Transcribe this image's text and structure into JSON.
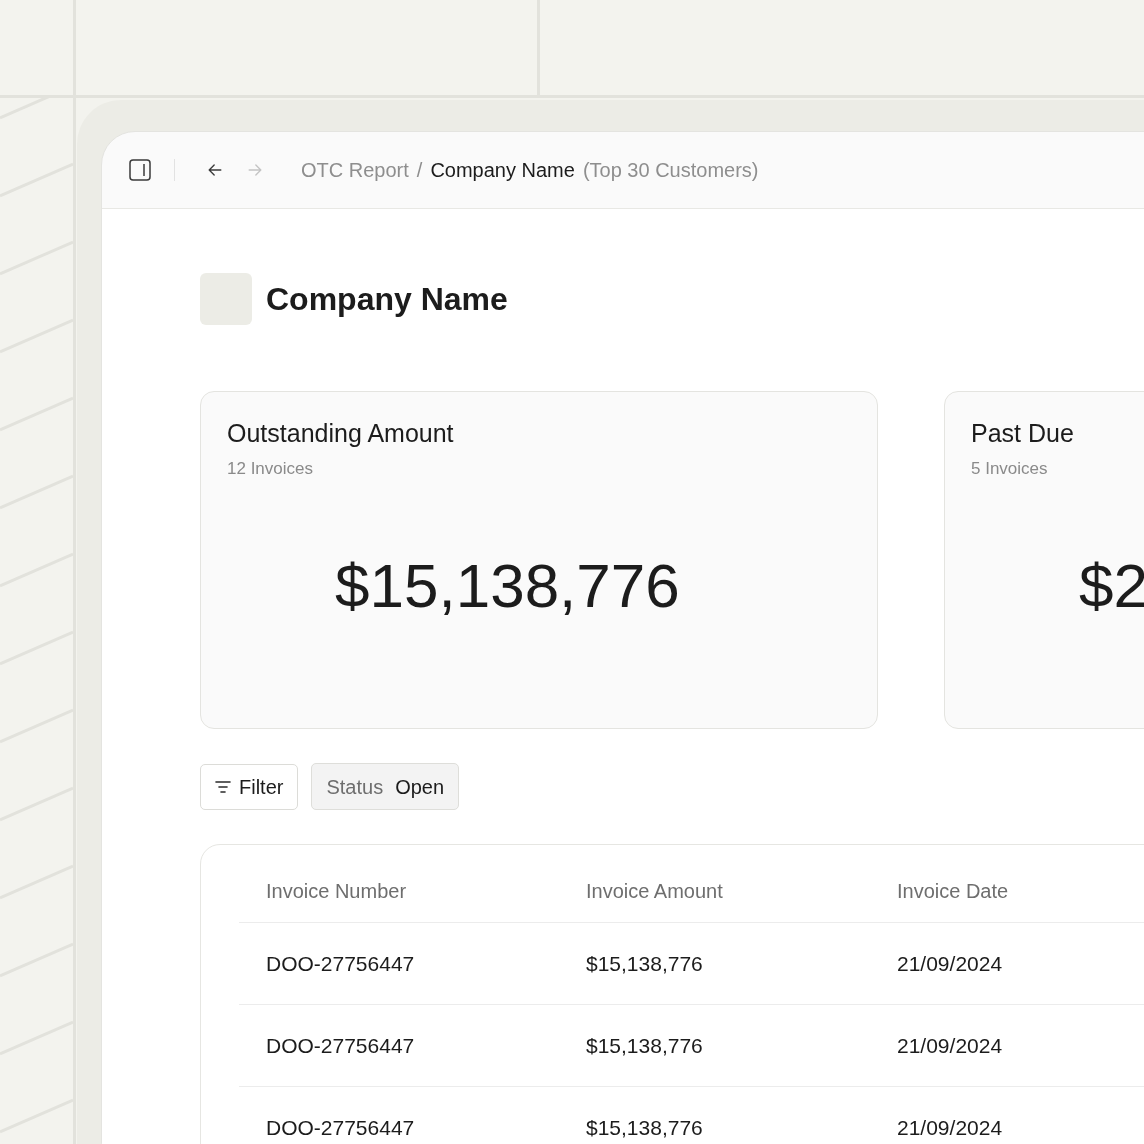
{
  "toolbar": {
    "nav": [
      {
        "kind": "back",
        "disabled": false
      },
      {
        "kind": "forward",
        "disabled": true
      }
    ],
    "breadcrumb": {
      "parent": "OTC Report",
      "separator": "/",
      "current": "Company Name",
      "note": "(Top 30 Customers)"
    }
  },
  "page": {
    "title": "Company Name"
  },
  "cards": [
    {
      "title": "Outstanding Amount",
      "subtitle": "12 Invoices",
      "value": "$15,138,776"
    },
    {
      "title": "Past Due",
      "subtitle": "5 Invoices",
      "value": "$2"
    }
  ],
  "filters": {
    "button": "Filter",
    "chips": [
      {
        "label": "Status",
        "value": "Open"
      }
    ]
  },
  "table": {
    "columns": [
      "Invoice Number",
      "Invoice Amount",
      "Invoice Date"
    ],
    "rows": [
      [
        "DOO-27756447",
        "$15,138,776",
        "21/09/2024"
      ],
      [
        "DOO-27756447",
        "$15,138,776",
        "21/09/2024"
      ],
      [
        "DOO-27756447",
        "$15,138,776",
        "21/09/2024"
      ]
    ]
  }
}
